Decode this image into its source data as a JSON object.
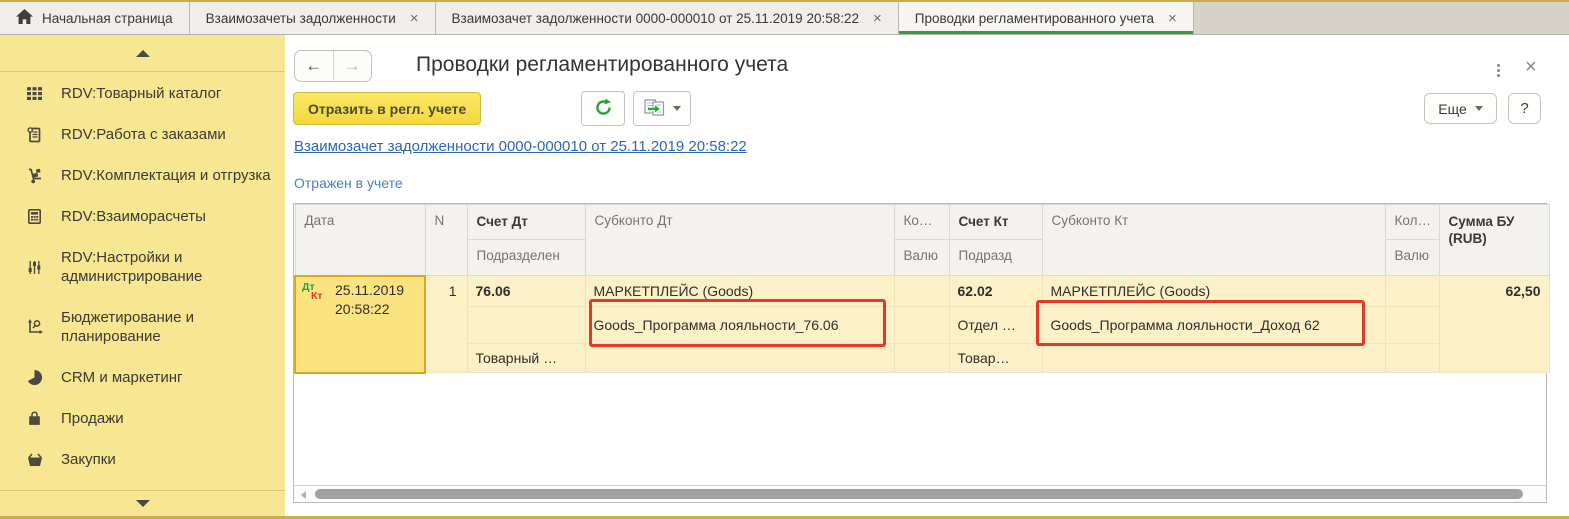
{
  "colors": {
    "accent_green": "#2d9e41",
    "sidebar_yellow": "#f7e692",
    "button_yellow": "#f6dd4c",
    "annotation_red": "#e0392d",
    "link_blue": "#2e66b3",
    "status_blue": "#4a7fc1",
    "debit_green": "#2e9e3e",
    "credit_red": "#d23b2e",
    "selected_cell_border": "#d9a81c",
    "row_yellow": "#fcf1c6"
  },
  "tabs": [
    {
      "icon": "home-icon",
      "label": "Начальная страница",
      "closable": false,
      "active": false
    },
    {
      "label": "Взаимозачеты задолженности",
      "closable": true,
      "active": false
    },
    {
      "label": "Взаимозачет задолженности 0000-000010 от 25.11.2019 20:58:22",
      "closable": true,
      "active": false
    },
    {
      "label": "Проводки регламентированного учета",
      "closable": true,
      "active": true
    }
  ],
  "sidebar": {
    "items": [
      {
        "icon": "catalog-grid-icon",
        "label": "RDV:Товарный каталог"
      },
      {
        "icon": "orders-icon",
        "label": "RDV:Работа с заказами"
      },
      {
        "icon": "shipping-icon",
        "label": "RDV:Комплектация и отгрузка"
      },
      {
        "icon": "calculator-icon",
        "label": "RDV:Взаиморасчеты"
      },
      {
        "icon": "settings-icon",
        "label": "RDV:Настройки и администрирование"
      },
      {
        "icon": "budget-icon",
        "label": "Бюджетирование и планирование"
      },
      {
        "icon": "crm-pie-icon",
        "label": "CRM и маркетинг"
      },
      {
        "icon": "sales-bag-icon",
        "label": "Продажи"
      },
      {
        "icon": "purchases-cart-icon",
        "label": "Закупки"
      }
    ]
  },
  "panel": {
    "title": "Проводки регламентированного учета",
    "reflect_button": "Отразить в регл. учете",
    "more_button": "Еще",
    "help_button": "?",
    "document_link": "Взаимозачет задолженности 0000-000010 от 25.11.2019 20:58:22",
    "status_text": "Отражен в учете"
  },
  "table": {
    "headers": {
      "date": "Дата",
      "n": "N",
      "debit_account": "Счет Дт",
      "debit_department": "Подразделен",
      "debit_subconto": "Субконто Дт",
      "qty_debit": "Ко…",
      "currency_debit": "Валю",
      "credit_account": "Счет Кт",
      "credit_department": "Подразд",
      "credit_subconto": "Субконто Кт",
      "qty_credit": "Кол…",
      "currency_credit": "Валю",
      "amount": "Сумма БУ (RUB)"
    },
    "row": {
      "debit_badge": "Дт",
      "credit_badge": "Кт",
      "date": "25.11.2019",
      "time": "20:58:22",
      "n": "1",
      "debit_account": "76.06",
      "debit_subconto_1": "МАРКЕТПЛЕЙС (Goods)",
      "debit_subconto_2": "Goods_Программа лояльности_76.06",
      "debit_department": "Товарный …",
      "credit_account": "62.02",
      "credit_department": "Отдел …",
      "credit_department_2": "Товар…",
      "credit_subconto_1": "МАРКЕТПЛЕЙС (Goods)",
      "credit_subconto_2": "Goods_Программа лояльности_Доход 62",
      "amount": "62,50"
    }
  }
}
